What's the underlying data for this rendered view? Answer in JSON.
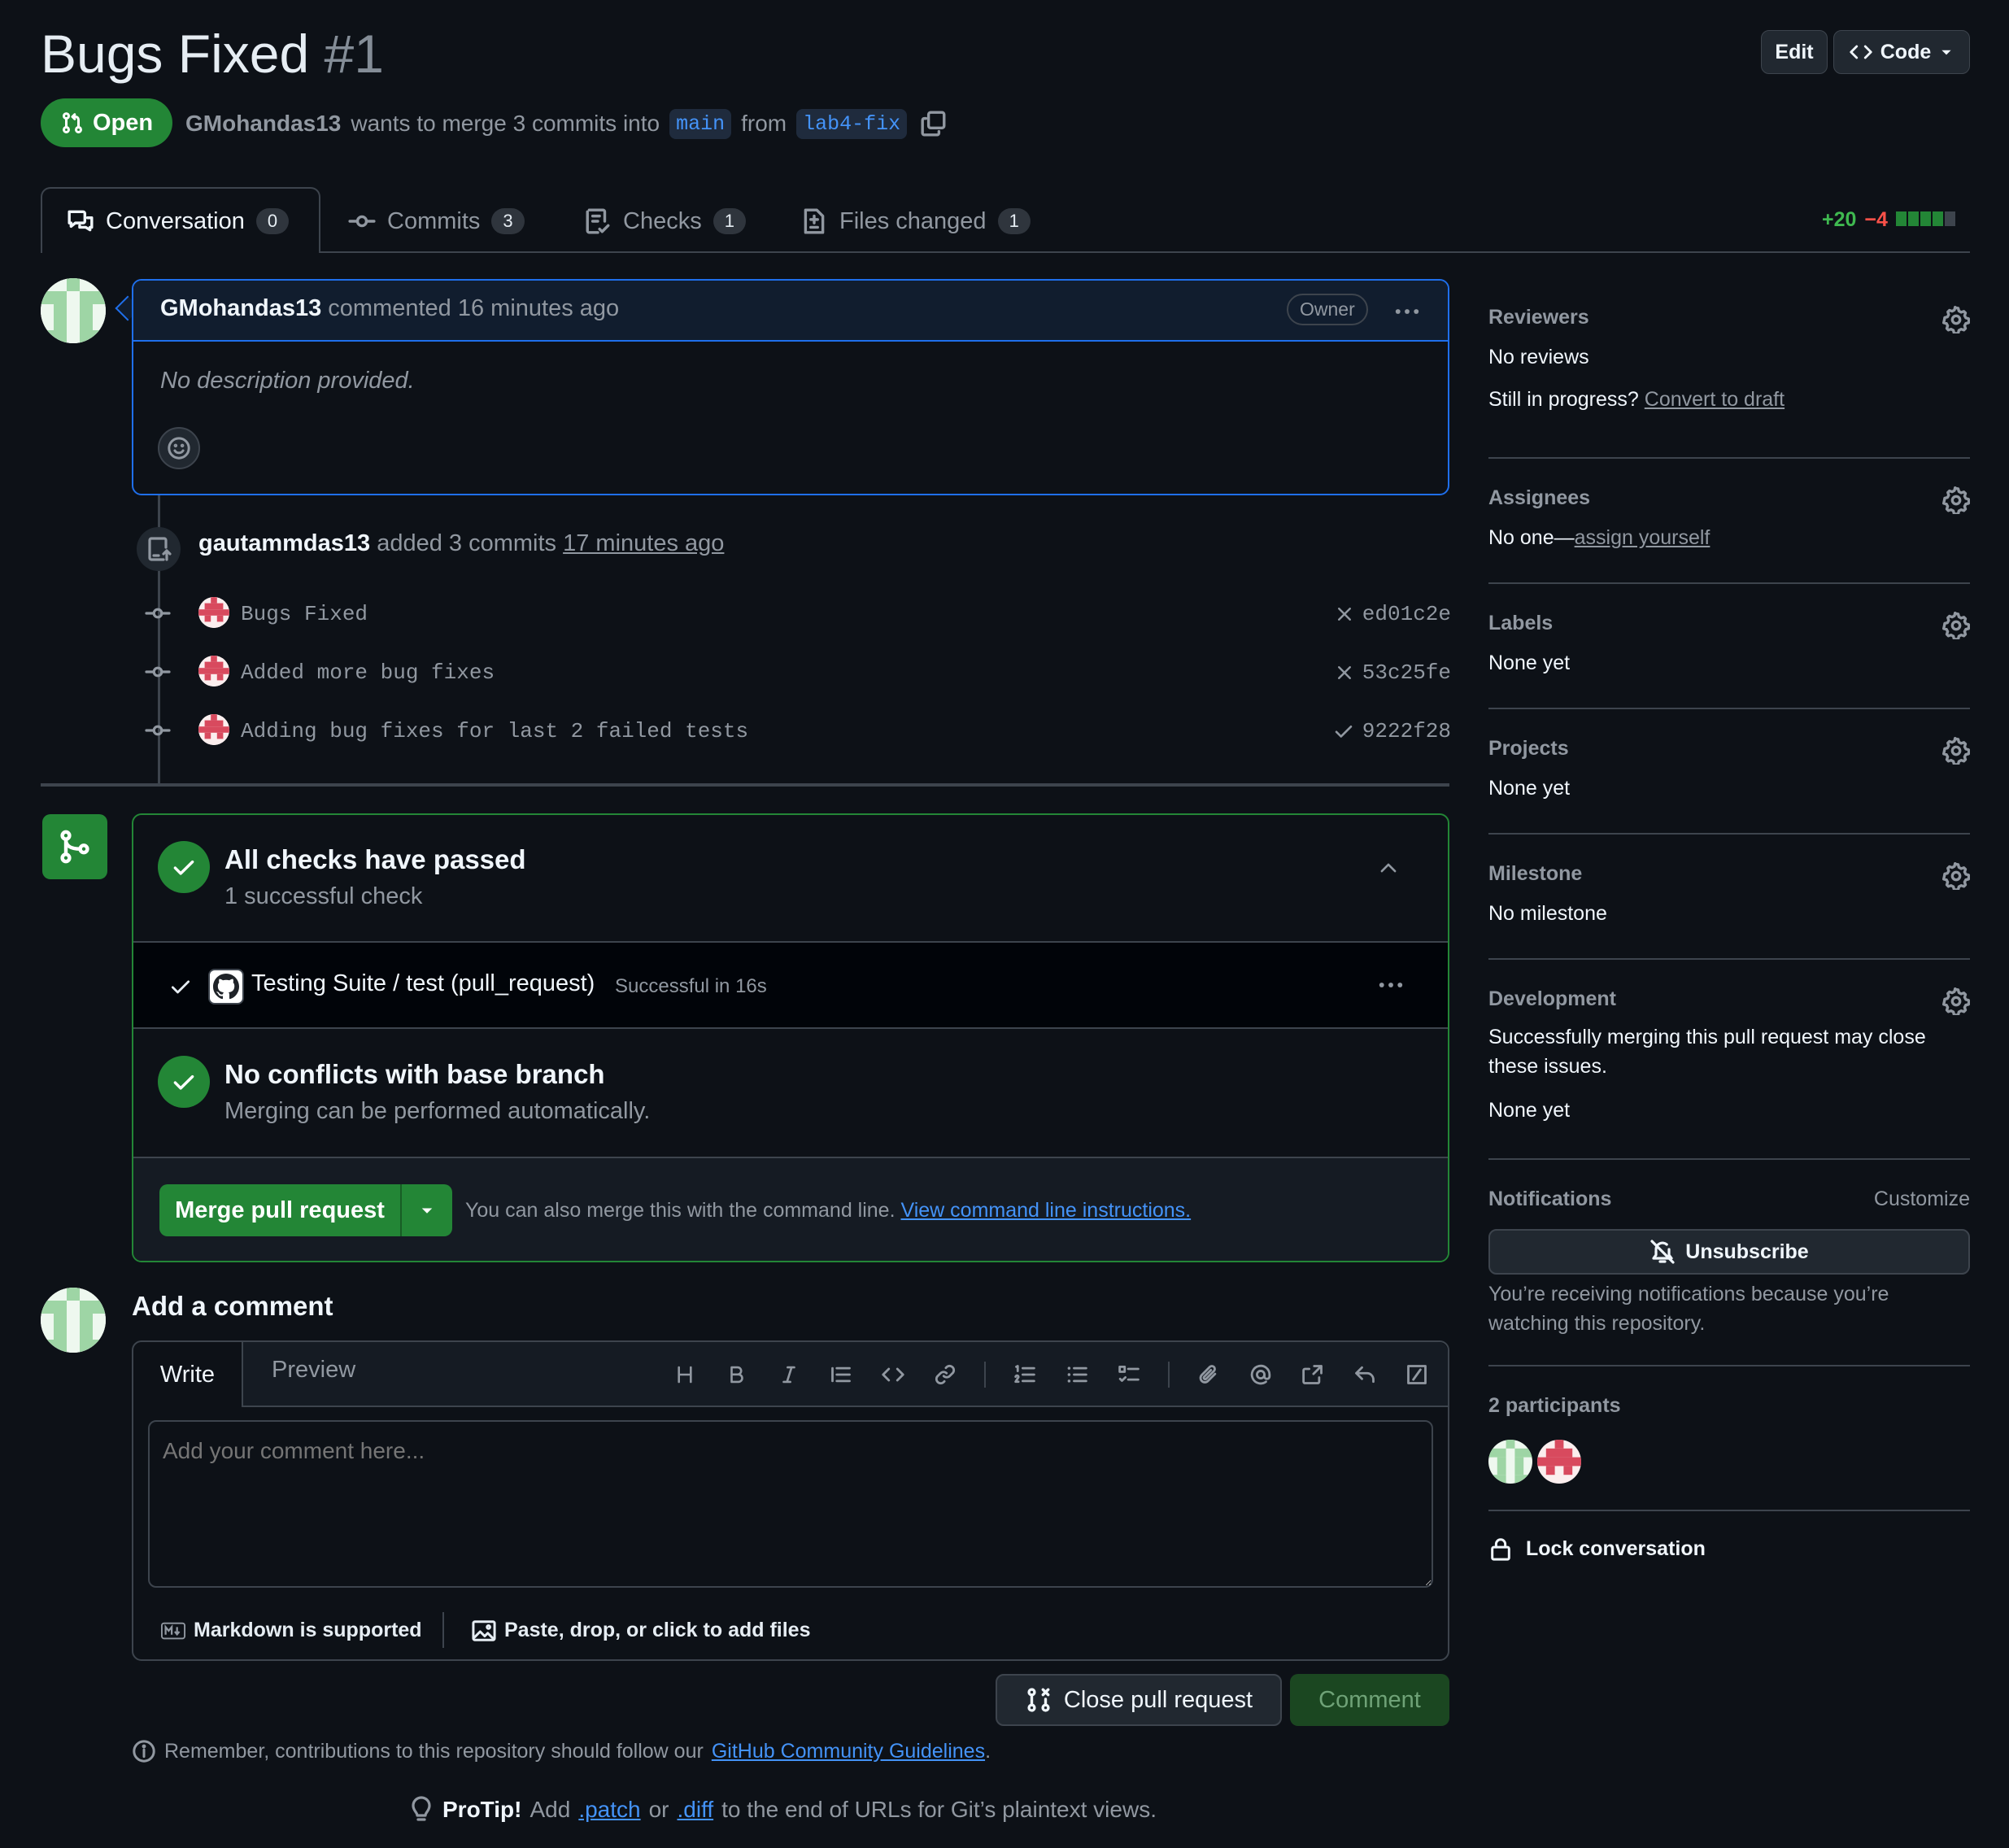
{
  "header": {
    "title": "Bugs Fixed",
    "number": "#1",
    "edit_label": "Edit",
    "code_label": "Code",
    "status": "Open",
    "author": "GMohandas13",
    "merge_text": "wants to merge 3 commits into",
    "base_branch": "main",
    "from_text": "from",
    "head_branch": "lab4-fix"
  },
  "tabs": [
    {
      "label": "Conversation",
      "count": "0",
      "icon": "comment-discussion-icon"
    },
    {
      "label": "Commits",
      "count": "3",
      "icon": "git-commit-icon"
    },
    {
      "label": "Checks",
      "count": "1",
      "icon": "checklist-icon"
    },
    {
      "label": "Files changed",
      "count": "1",
      "icon": "file-diff-icon"
    }
  ],
  "diffstat": {
    "additions": "+20",
    "deletions": "−4",
    "blocks": [
      "green",
      "green",
      "green",
      "green",
      "gray"
    ]
  },
  "comment": {
    "author": "GMohandas13",
    "action": "commented 16 minutes ago",
    "badge": "Owner",
    "body": "No description provided."
  },
  "commit_event": {
    "author": "gautammdas13",
    "action": "added 3 commits",
    "time": "17 minutes ago"
  },
  "commits": [
    {
      "message": "Bugs Fixed",
      "sha": "ed01c2e",
      "status": "failure"
    },
    {
      "message": "Added more bug fixes",
      "sha": "53c25fe",
      "status": "failure"
    },
    {
      "message": "Adding bug fixes for last 2 failed tests",
      "sha": "9222f28",
      "status": "success"
    }
  ],
  "merge_box": {
    "checks_title": "All checks have passed",
    "checks_sub": "1 successful check",
    "check_name": "Testing Suite / test (pull_request)",
    "check_status": "Successful in 16s",
    "conflicts_title": "No conflicts with base branch",
    "conflicts_sub": "Merging can be performed automatically.",
    "merge_button": "Merge pull request",
    "hint": "You can also merge this with the command line.",
    "hint_link": "View command line instructions."
  },
  "add_comment": {
    "title": "Add a comment",
    "tab_write": "Write",
    "tab_preview": "Preview",
    "placeholder": "Add your comment here...",
    "markdown_note": "Markdown is supported",
    "files_note": "Paste, drop, or click to add files",
    "close_button": "Close pull request",
    "comment_button": "Comment",
    "guidelines_text": "Remember, contributions to this repository should follow our",
    "guidelines_link": "GitHub Community Guidelines",
    "guidelines_end": "."
  },
  "protip": {
    "label": "ProTip!",
    "t1": "Add",
    "patch": ".patch",
    "t2": "or",
    "diff": ".diff",
    "t3": "to the end of URLs for Git’s plaintext views."
  },
  "sidebar": {
    "reviewers": {
      "title": "Reviewers",
      "value": "No reviews",
      "progress_text": "Still in progress?",
      "convert_link": "Convert to draft"
    },
    "assignees": {
      "title": "Assignees",
      "value": "No one—",
      "link": "assign yourself"
    },
    "labels": {
      "title": "Labels",
      "value": "None yet"
    },
    "projects": {
      "title": "Projects",
      "value": "None yet"
    },
    "milestone": {
      "title": "Milestone",
      "value": "No milestone"
    },
    "development": {
      "title": "Development",
      "text": "Successfully merging this pull request may close these issues.",
      "value": "None yet"
    },
    "notifications": {
      "title": "Notifications",
      "customize": "Customize",
      "button": "Unsubscribe",
      "text": "You’re receiving notifications because you’re watching this repository."
    },
    "participants": {
      "title": "2 participants"
    },
    "lock": "Lock conversation"
  },
  "colors": {
    "accent": "#238636",
    "link": "#4493f8",
    "failure": "#f85149",
    "success": "#3fb950",
    "background": "#0d1117"
  }
}
